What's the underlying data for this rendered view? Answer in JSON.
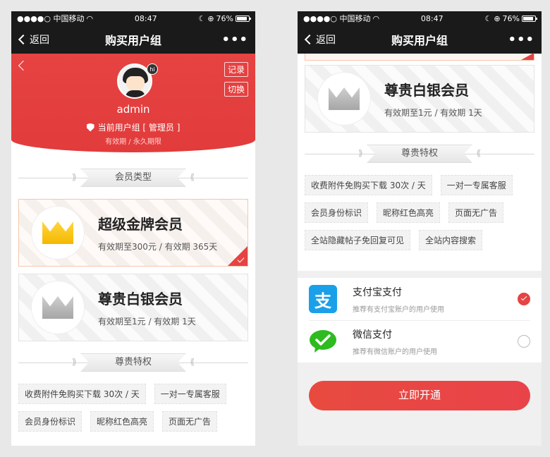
{
  "status_bar": {
    "carrier": "●●●●○ 中国移动",
    "time": "08:47",
    "battery": "76%"
  },
  "nav": {
    "back_label": "返回",
    "title": "购买用户组",
    "more_label": "•••"
  },
  "profile": {
    "record_btn": "记录",
    "switch_btn": "切换",
    "hi_badge": "hi",
    "username": "admin",
    "current_group": "当前用户组 [ 管理员 ]",
    "validity": "有效期 / 永久期限"
  },
  "sections": {
    "member_type": "会员类型",
    "privileges": "尊贵特权"
  },
  "plans": [
    {
      "name": "超级金牌会员",
      "period": "有效期至300元 / 有效期 365天",
      "crown": "gold",
      "selected": true
    },
    {
      "name": "尊贵白银会员",
      "period": "有效期至1元 / 有效期 1天",
      "crown": "silver",
      "selected": false
    }
  ],
  "privilege_tags": [
    "收费附件免购买下载 30次 / 天",
    "一对一专属客服",
    "会员身份标识",
    "昵称红色高亮",
    "页面无广告",
    "全站隐藏帖子免回复可见",
    "全站内容搜索"
  ],
  "payment": {
    "methods": [
      {
        "name": "支付宝支付",
        "desc": "推荐有支付宝账户的用户使用",
        "icon": "alipay-icon",
        "icon_glyph": "支",
        "selected": true
      },
      {
        "name": "微信支付",
        "desc": "推荐有微信账户的用户使用",
        "icon": "wechat-icon",
        "selected": false
      }
    ],
    "submit_label": "立即开通"
  },
  "colors": {
    "brand_red": "#e64343",
    "alipay_blue": "#1aa0e8",
    "wechat_green": "#2dbb1f"
  }
}
